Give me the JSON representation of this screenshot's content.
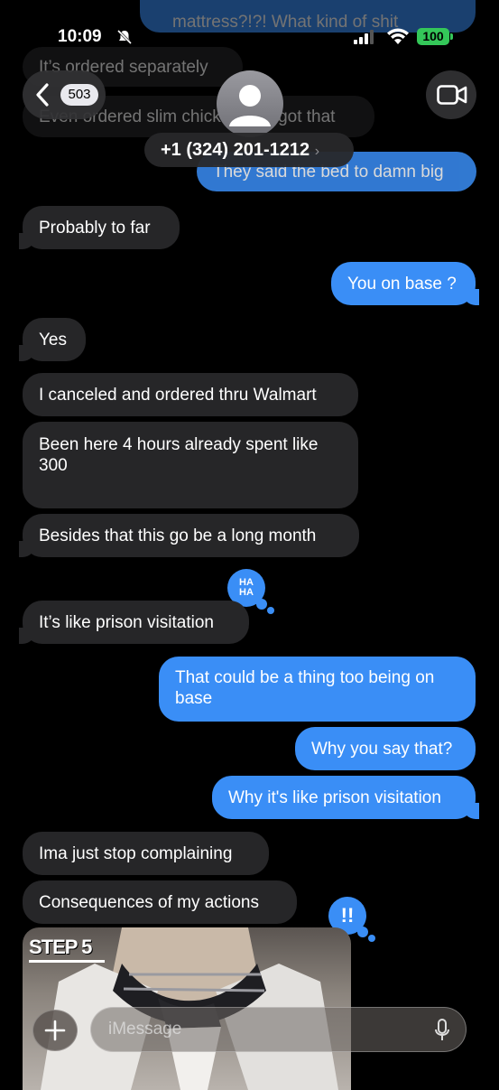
{
  "status_bar": {
    "time": "10:09",
    "battery": "100"
  },
  "header": {
    "back_count": "503",
    "contact_number": "+1 (324) 201-1212"
  },
  "ghost_messages": {
    "top_sent": "mattress?!?! What kind of shit",
    "recv_1": "It’s ordered separately",
    "recv_2": "Even ordered slim chicken and got that",
    "sent_1": "They said the bed to damn big"
  },
  "messages": [
    {
      "text": "Probably to far"
    },
    {
      "text": "You on base ?"
    },
    {
      "text": "Yes"
    },
    {
      "text": "I canceled and ordered thru Walmart"
    },
    {
      "text": "Been here 4 hours already spent like 300"
    },
    {
      "text": "Besides that this go be a long month"
    },
    {
      "text": "It’s like prison visitation"
    },
    {
      "text": "That could be a thing too being on base"
    },
    {
      "text": "Why you say that?"
    },
    {
      "text": "Why it's like prison visitation"
    },
    {
      "text": "Ima just stop complaining"
    },
    {
      "text": "Consequences of my actions"
    }
  ],
  "tapbacks": {
    "haha": "HA HA",
    "emphasis": "!!"
  },
  "image_attachment": {
    "caption": "STEP 5"
  },
  "composer": {
    "placeholder": "iMessage"
  },
  "colors": {
    "sent": "#3a8ef6",
    "received": "#262628",
    "background": "#000000",
    "battery": "#34c759"
  }
}
